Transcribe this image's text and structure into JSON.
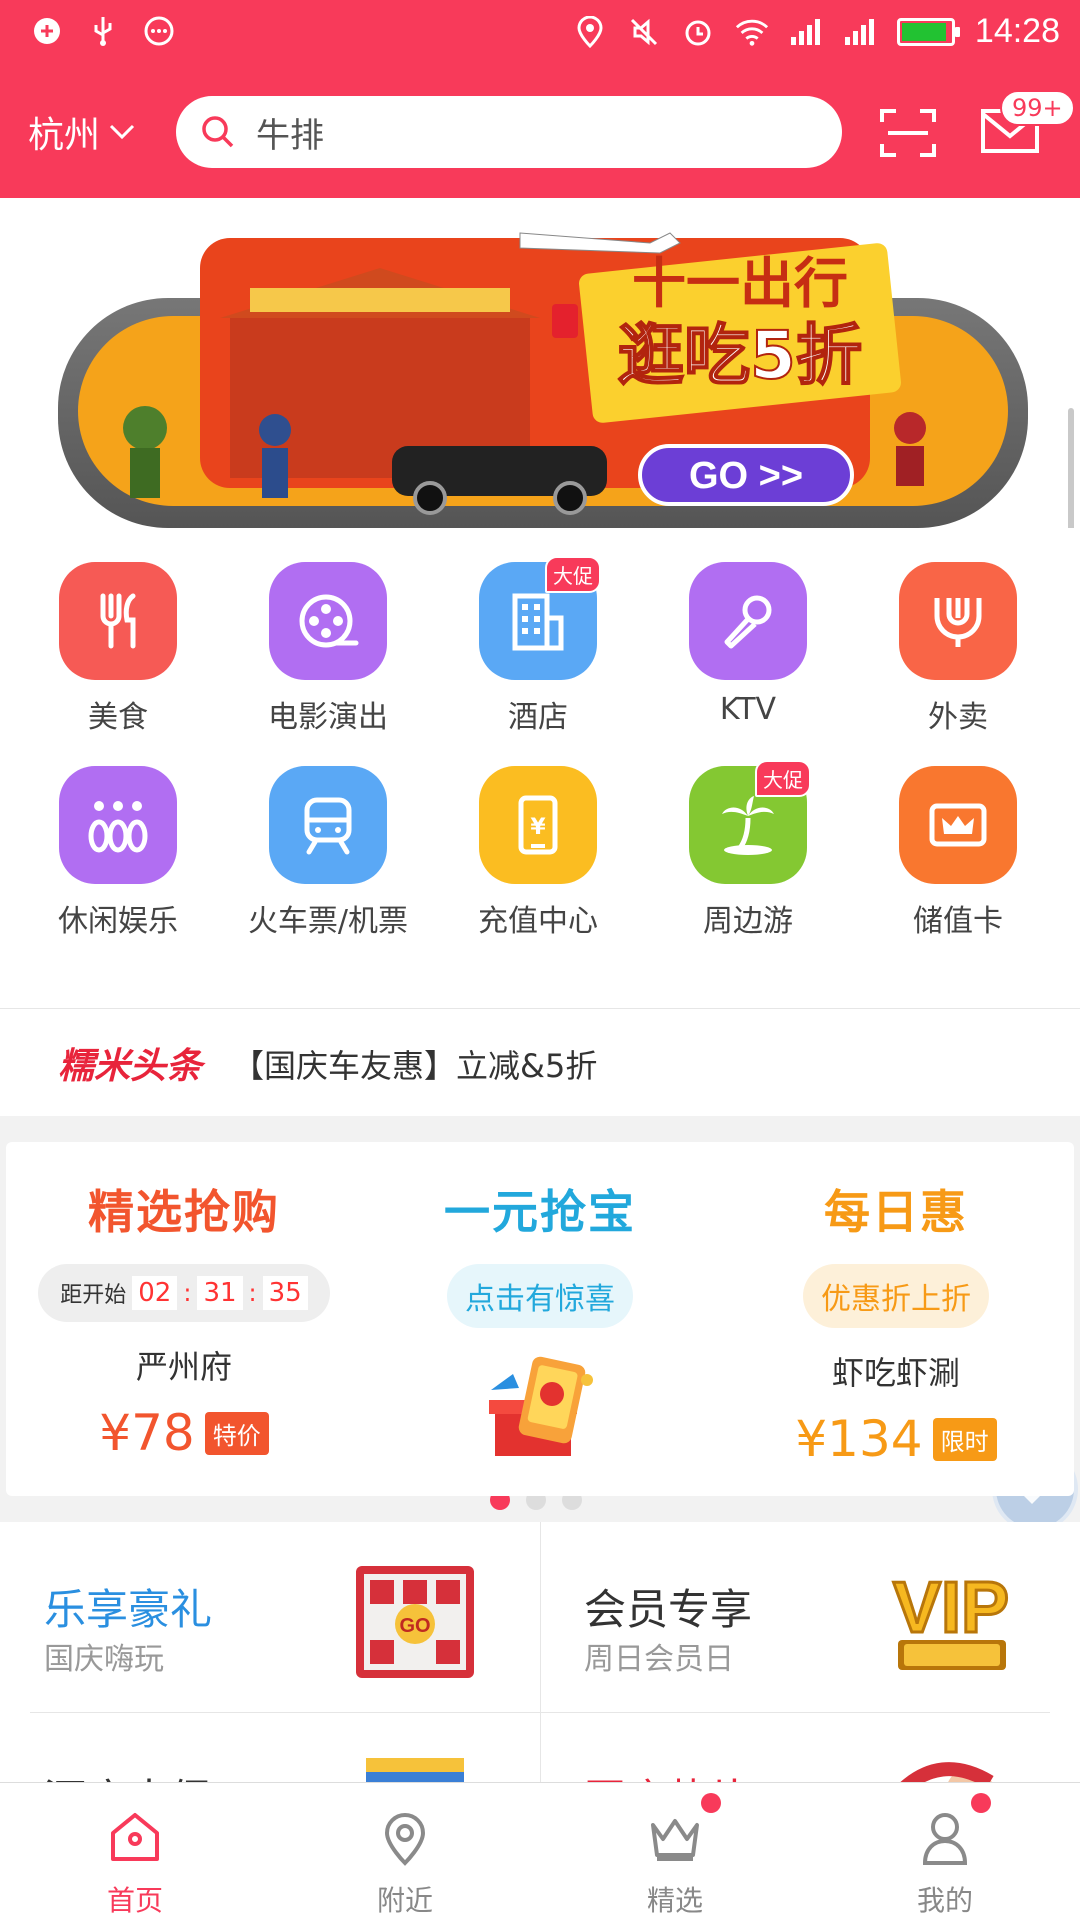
{
  "status_bar": {
    "time": "14:28",
    "battery_level": 0.85,
    "left_icons": [
      "location-badge-icon",
      "usb-icon",
      "more-dots-icon"
    ],
    "right_icons": [
      "location-pin-icon",
      "mute-icon",
      "alarm-icon",
      "wifi-icon",
      "signal-icon",
      "signal-icon",
      "battery-icon"
    ]
  },
  "header": {
    "city": "杭州",
    "search_text": "牛排",
    "mail_badge": "99+",
    "icons": [
      "chevron-down-icon",
      "search-icon",
      "scan-icon",
      "mail-icon"
    ]
  },
  "banner": {
    "headline": "十一出行",
    "subline": "逛吃5折",
    "button": "GO >>",
    "page_count": 2,
    "active_page": 1
  },
  "categories": [
    {
      "label": "美食",
      "icon": "fork-knife-icon",
      "color": "#f65a55",
      "tag": ""
    },
    {
      "label": "电影演出",
      "icon": "film-reel-icon",
      "color": "#b16ef2",
      "tag": ""
    },
    {
      "label": "酒店",
      "icon": "hotel-building-icon",
      "color": "#5aa8f5",
      "tag": "大促"
    },
    {
      "label": "KTV",
      "icon": "microphone-icon",
      "color": "#b16ef2",
      "tag": ""
    },
    {
      "label": "外卖",
      "icon": "takeout-bowl-icon",
      "color": "#f96547",
      "tag": ""
    },
    {
      "label": "休闲娱乐",
      "icon": "bowling-pins-icon",
      "color": "#b16ef2",
      "tag": ""
    },
    {
      "label": "火车票/机票",
      "icon": "train-icon",
      "color": "#5aa8f5",
      "tag": ""
    },
    {
      "label": "充值中心",
      "icon": "phone-recharge-icon",
      "color": "#fbbd21",
      "tag": ""
    },
    {
      "label": "周边游",
      "icon": "palm-tree-icon",
      "color": "#84c832",
      "tag": "大促"
    },
    {
      "label": "储值卡",
      "icon": "crown-card-icon",
      "color": "#f9772f",
      "tag": ""
    }
  ],
  "category_pager": {
    "page_count": 3,
    "active_page": 1
  },
  "headline": {
    "logo": "糯米头条",
    "text": "【国庆车友惠】立减&5折"
  },
  "deals": {
    "flash": {
      "title": "精选抢购",
      "countdown_label": "距开始",
      "hh": "02",
      "mm": "31",
      "ss": "35",
      "shop": "严州府",
      "price": "¥78",
      "tag": "特价",
      "color": "#f2552e"
    },
    "one_yuan": {
      "title": "一元抢宝",
      "pill": "点击有惊喜",
      "color": "#22a8dc"
    },
    "daily": {
      "title": "每日惠",
      "pill": "优惠折上折",
      "shop": "虾吃虾涮",
      "price": "¥134",
      "tag": "限时",
      "color": "#f79a16"
    }
  },
  "promos": [
    {
      "title": "乐享豪礼",
      "subtitle": "国庆嗨玩",
      "title_color": "#2a8fe0"
    },
    {
      "title": "会员专享",
      "subtitle": "周日会员日",
      "title_color": "#333333"
    },
    {
      "title": "酒店大促",
      "subtitle": "",
      "title_color": "#333333"
    },
    {
      "title": "国庆热片",
      "subtitle": "",
      "title_color": "#e8243b"
    }
  ],
  "tabs": [
    {
      "label": "首页",
      "icon": "home-icon",
      "active": true,
      "badge": false
    },
    {
      "label": "附近",
      "icon": "location-pin-icon",
      "active": false,
      "badge": false
    },
    {
      "label": "精选",
      "icon": "crown-icon",
      "active": false,
      "badge": true
    },
    {
      "label": "我的",
      "icon": "person-icon",
      "active": false,
      "badge": true
    }
  ],
  "colors": {
    "brand": "#f83a5a",
    "accent_red": "#e8243b"
  }
}
